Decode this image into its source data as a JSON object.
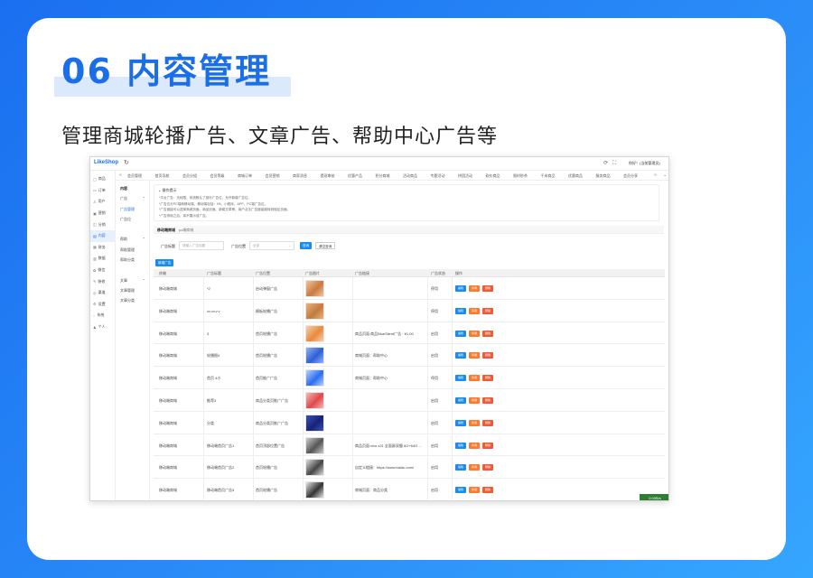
{
  "slide": {
    "title": "06 内容管理",
    "subtitle": "管理商城轮播广告、文章广告、帮助中心广告等"
  },
  "app": {
    "logo": "LikeShop",
    "refresh_icon": "↻",
    "user": "你好！(当前管理员)"
  },
  "sidebar": {
    "items": [
      {
        "label": "商品",
        "icon": "▢"
      },
      {
        "label": "订单",
        "icon": "▭"
      },
      {
        "label": "用户",
        "icon": "♙"
      },
      {
        "label": "营销",
        "icon": "▣"
      },
      {
        "label": "分销",
        "icon": "◫"
      },
      {
        "label": "内容",
        "icon": "▤",
        "active": true
      },
      {
        "label": "财务",
        "icon": "▦"
      },
      {
        "label": "数据",
        "icon": "▥"
      },
      {
        "label": "微信",
        "icon": "✿"
      },
      {
        "label": "装修",
        "icon": "✎"
      },
      {
        "label": "渠道",
        "icon": "◎"
      },
      {
        "label": "设置",
        "icon": "⚙"
      },
      {
        "label": "系统",
        "icon": "◌"
      },
      {
        "label": "个人",
        "icon": "♟"
      }
    ]
  },
  "subnav": {
    "items": [
      {
        "label": "内容",
        "bold": true
      },
      {
        "label": "广告",
        "chev": "⌃"
      },
      {
        "label": "广告管理",
        "active": true
      },
      {
        "label": "广告位"
      },
      {
        "label": ""
      },
      {
        "label": "帮助",
        "chev": "⌃"
      },
      {
        "label": "帮助管理"
      },
      {
        "label": "帮助分类"
      },
      {
        "label": ""
      },
      {
        "label": "文章",
        "chev": "⌃"
      },
      {
        "label": "文章管理"
      },
      {
        "label": "文章分类"
      }
    ]
  },
  "tabs": {
    "items": [
      "会员管理",
      "首页导航",
      "会员分组",
      "会员等级",
      "商城订单",
      "会员营销",
      "商家消息",
      "提现审核",
      "优惠产品",
      "积分商城",
      "活动商品",
      "专题活动",
      "拼团活动",
      "砍价商品",
      "限时秒杀",
      "千米商品",
      "优惠商品",
      "服务商品",
      "会员分享"
    ]
  },
  "notice": {
    "title": "操作提示",
    "lines": [
      "*平台广告：无权限。系统默认了部分广告位，允许新增广告位。",
      "*广告位分PC端和移动端，移动端包括：H5、小程序、APP、PC端广告位。",
      "*广告链接可以选择商城页面、商品页面、新闻文章等，用户点击广告链接跳转到相应页面。",
      "*广告停用之后，将不展示该广告。"
    ]
  },
  "view_tabs": {
    "active": "移动端商城",
    "inactive": "pc端商城"
  },
  "filter": {
    "name_label": "广告标题",
    "name_placeholder": "请输入广告标题",
    "pos_label": "广告位置",
    "pos_placeholder": "全部",
    "search_btn": "查询",
    "reset_btn": "清空查询"
  },
  "add_button": "新增广告",
  "table": {
    "headers": [
      "终端",
      "广告标题",
      "广告位置",
      "广告图片",
      "广告链接",
      "广告状态",
      "操作"
    ],
    "ops": {
      "edit": "编辑",
      "stop": "停用",
      "del": "删除"
    },
    "rows": [
      {
        "terminal": "移动端商城",
        "title": "*2",
        "position": "启动弹窗广告",
        "link": "",
        "status": "停用",
        "img": "#c97940",
        "img2": "#f2c49a"
      },
      {
        "terminal": "移动端商城",
        "title": "vv.vv.v.v",
        "position": "模板轮播广告",
        "link": "",
        "status": "停用",
        "img": "#c47a3e",
        "img2": "#e9b27a"
      },
      {
        "terminal": "移动端商城",
        "title": "3",
        "position": "首页轮播广告",
        "link": "商品页面:商品BlueSilent广告 · ¥1.00",
        "status": "启用",
        "img": "#e98a3f",
        "img2": "#f6d0b0"
      },
      {
        "terminal": "移动端商城",
        "title": "轮播图4",
        "position": "首页轮播广告",
        "link": "商城页面：帮助中心",
        "status": "启用",
        "img": "#2d5fd6",
        "img2": "#8fb2ff"
      },
      {
        "terminal": "移动端商城",
        "title": "首页 4小",
        "position": "首页推广广告",
        "link": "商城页面：帮助中心",
        "status": "停用",
        "img": "#2b6ef0",
        "img2": "#b7d0ff"
      },
      {
        "terminal": "移动端商城",
        "title": "推荐3",
        "position": "商品分类页推广广告",
        "link": "",
        "status": "启用",
        "img": "#e0484a",
        "img2": "#f6b6b6"
      },
      {
        "terminal": "移动端商城",
        "title": "分类",
        "position": "商品分类页推广广告",
        "link": "",
        "status": "启用",
        "img": "#16237a",
        "img2": "#3d4fb0"
      },
      {
        "terminal": "移动端商城",
        "title": "移动端首页广告1",
        "position": "首页顶部位置广告",
        "link": "商品页面:vivo x21 全面屏双摄 6G+64G ...",
        "status": "启用",
        "img": "#555555",
        "img2": "#cccccc"
      },
      {
        "terminal": "移动端商城",
        "title": "移动端首页广告2",
        "position": "首页轮播广告",
        "link": "自定义链接：https://www.baidu.com/",
        "status": "启用",
        "img": "#444444",
        "img2": "#dddddd"
      },
      {
        "terminal": "移动端商城",
        "title": "移动端首页广告3",
        "position": "首页轮播广告",
        "link": "商城页面：商品分类",
        "status": "启用",
        "img": "#333333",
        "img2": "#e5e5e5"
      }
    ]
  },
  "badge": "0.00B/s"
}
